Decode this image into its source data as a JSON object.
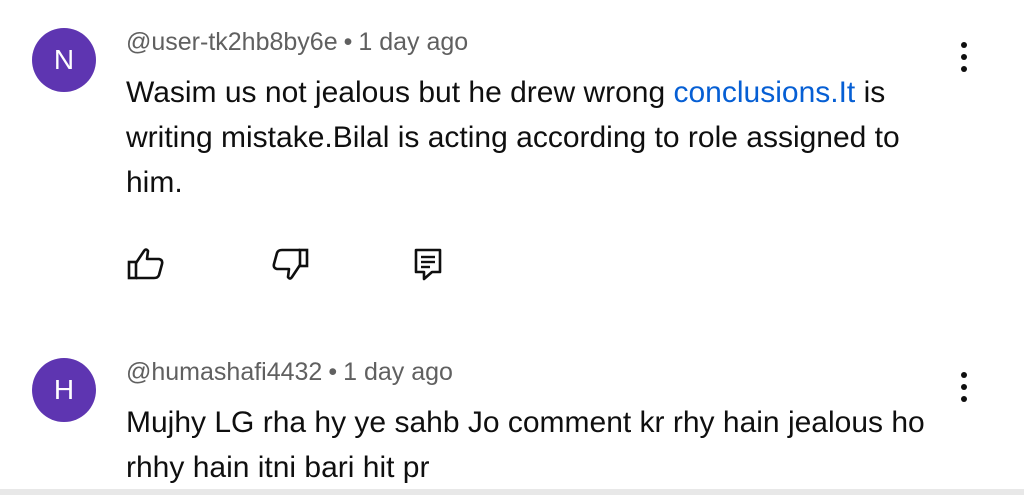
{
  "comments": [
    {
      "avatar_letter": "N",
      "handle": "@user-tk2hb8by6e",
      "separator": "•",
      "time": "1 day ago",
      "text_before_link": "Wasim us not jealous but he drew wrong ",
      "link_text": "conclusions.It",
      "text_after_link": " is writing mistake.Bilal is acting according to role assigned to him."
    },
    {
      "avatar_letter": "H",
      "handle": "@humashafi4432",
      "separator": "•",
      "time": "1 day ago",
      "text": "Mujhy LG rha hy ye sahb Jo comment kr rhy hain jealous ho rhhy hain itni bari hit pr"
    }
  ],
  "colors": {
    "avatar": "#5e35b1",
    "link": "#065fd4",
    "meta": "#606060"
  },
  "icons": {
    "like": "thumbs-up-icon",
    "dislike": "thumbs-down-icon",
    "reply": "comment-icon",
    "more": "more-vertical-icon"
  }
}
